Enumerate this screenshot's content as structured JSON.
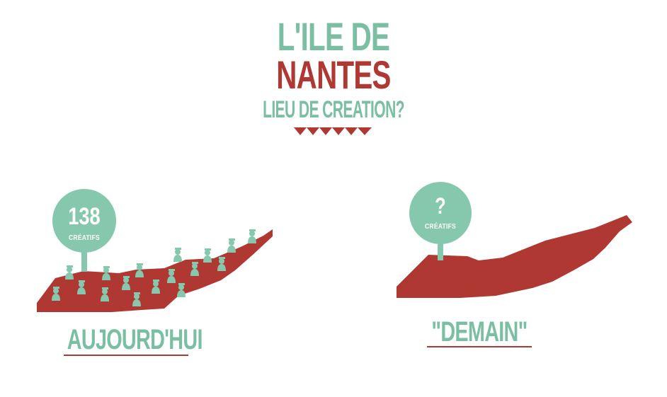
{
  "title": {
    "line1": "L'ILE DE",
    "line2": "NANTES",
    "line3": "LIEU DE CREATION?"
  },
  "left_panel": {
    "count": "138",
    "count_label": "CRÉATIFS",
    "caption": "AUJOURD'HUI"
  },
  "right_panel": {
    "count": "?",
    "count_label": "CRÉATIFS",
    "caption": "\"DEMAIN\""
  },
  "colors": {
    "green": "#86c8ae",
    "red": "#b03833",
    "text_green": "#7bbfa2"
  },
  "icons": [
    "person-icon",
    "scallop-decoration-icon"
  ]
}
